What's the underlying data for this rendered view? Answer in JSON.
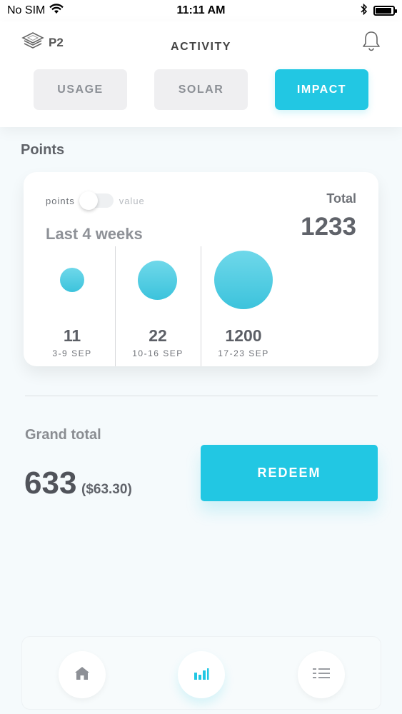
{
  "status_bar": {
    "carrier": "No SIM",
    "time": "11:11 AM",
    "battery_level": 0.9
  },
  "header": {
    "logo_text": "P2",
    "title": "ACTIVITY",
    "tabs": [
      {
        "label": "USAGE",
        "active": false
      },
      {
        "label": "SOLAR",
        "active": false
      },
      {
        "label": "IMPACT",
        "active": true
      }
    ]
  },
  "points": {
    "section_title": "Points",
    "toggle": {
      "left_label": "points",
      "right_label": "value",
      "selected": "points"
    },
    "range_label": "Last 4 weeks",
    "total_label": "Total",
    "total_value": "1233",
    "weeks": [
      {
        "value": "11",
        "range": "3-9 SEP"
      },
      {
        "value": "22",
        "range": "10-16 SEP"
      },
      {
        "value": "1200",
        "range": "17-23 SEP"
      }
    ]
  },
  "grand_total": {
    "label": "Grand total",
    "value": "633",
    "money": "($63.30)"
  },
  "redeem_label": "REDEEM",
  "bottom_nav": [
    {
      "icon": "home-icon",
      "active": false
    },
    {
      "icon": "bar-chart-icon",
      "active": true
    },
    {
      "icon": "menu-list-icon",
      "active": false
    }
  ],
  "colors": {
    "accent": "#22c7e3",
    "bubble": "#4fcde3",
    "background": "#f5fafc"
  }
}
